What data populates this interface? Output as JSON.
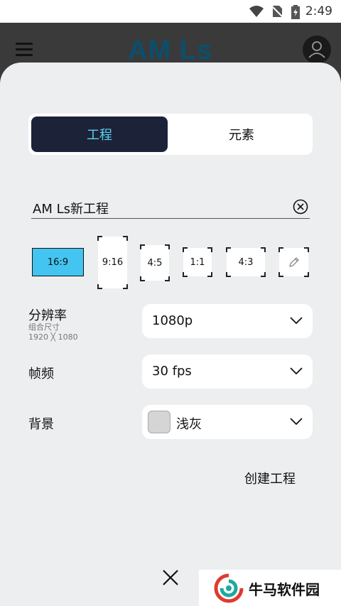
{
  "status_bar": {
    "time": "2:49"
  },
  "app_bar": {
    "logo": "AM Ls"
  },
  "tabs": [
    {
      "label": "工程"
    },
    {
      "label": "元素"
    }
  ],
  "project": {
    "name": "AM Ls新工程"
  },
  "ratios": [
    "16:9",
    "9:16",
    "4:5",
    "1:1",
    "4:3"
  ],
  "selected_ratio": "16:9",
  "resolution": {
    "label": "分辨率",
    "sub_label": "组合尺寸",
    "size": "1920 ╳ 1080",
    "value": "1080p"
  },
  "frame_rate": {
    "label": "帧频",
    "value": "30 fps"
  },
  "background": {
    "label": "背景",
    "value": "浅灰",
    "swatch_color": "#d5d5d5"
  },
  "actions": {
    "create": "创建工程"
  },
  "watermark": {
    "text": "牛马软件园"
  },
  "colors": {
    "accent": "#5ad3f0",
    "dark": "#1c2238",
    "selected_ratio_bg": "#44c4f0",
    "sheet_bg": "#edeef0"
  }
}
